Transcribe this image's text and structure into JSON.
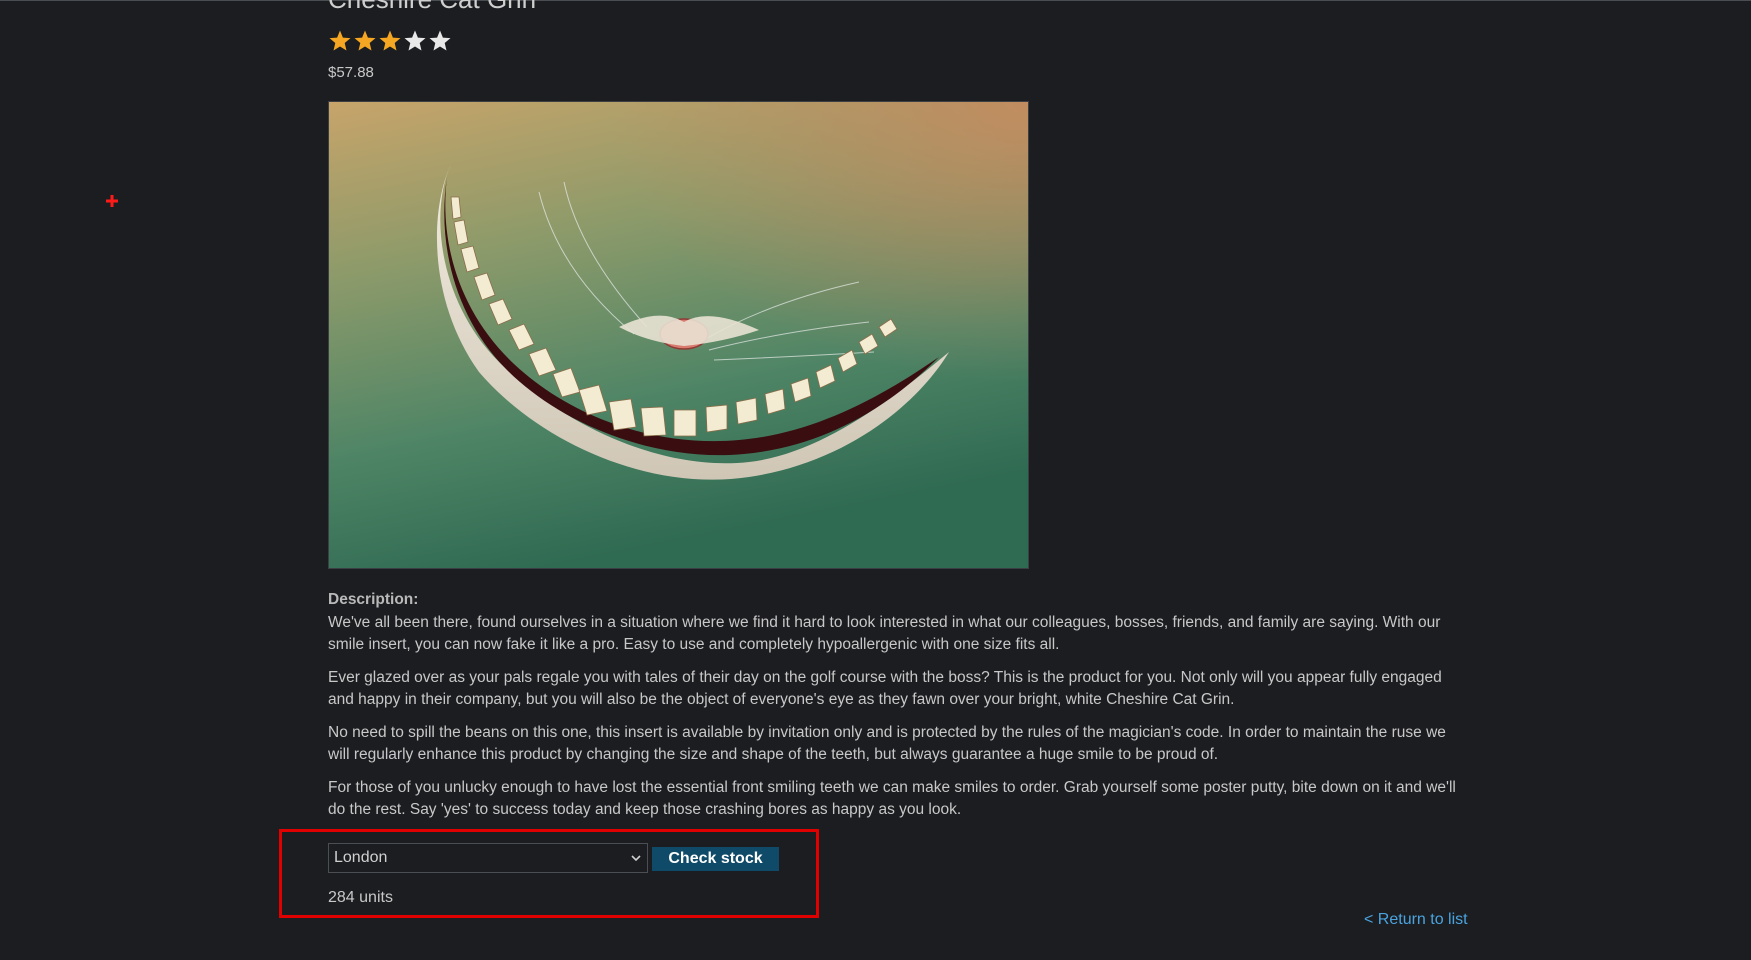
{
  "product": {
    "title": "Cheshire Cat Grin",
    "rating": 3,
    "rating_max": 5,
    "price": "$57.88",
    "image_alt": "Cheshire Cat Grin"
  },
  "description": {
    "label": "Description:",
    "paragraphs": [
      "We've all been there, found ourselves in a situation where we find it hard to look interested in what our colleagues, bosses, friends, and family are saying. With our smile insert, you can now fake it like a pro. Easy to use and completely hypoallergenic with one size fits all.",
      "Ever glazed over as your pals regale you with tales of their day on the golf course with the boss? This is the product for you. Not only will you appear fully engaged and happy in their company, but you will also be the object of everyone's eye as they fawn over your bright, white Cheshire Cat Grin.",
      "No need to spill the beans on this one, this insert is available by invitation only and is protected by the rules of the magician's code. In order to maintain the ruse we will regularly enhance this product by changing the size and shape of the teeth, but always guarantee a huge smile to be proud of.",
      "For those of you unlucky enough to have lost the essential front smiling teeth we can make smiles to order. Grab yourself some poster putty, bite down on it and we'll do the rest. Say 'yes' to success today and keep those crashing bores as happy as you look."
    ]
  },
  "stock": {
    "selected_store": "London",
    "button_label": "Check stock",
    "result": "284 units"
  },
  "nav": {
    "return_label": "< Return to list"
  },
  "colors": {
    "background": "#1b1d20",
    "star_filled": "#f5a623",
    "star_empty": "#e8e8e8",
    "button_bg": "#0f4a68",
    "link": "#4aa3df",
    "highlight": "#e00000"
  }
}
